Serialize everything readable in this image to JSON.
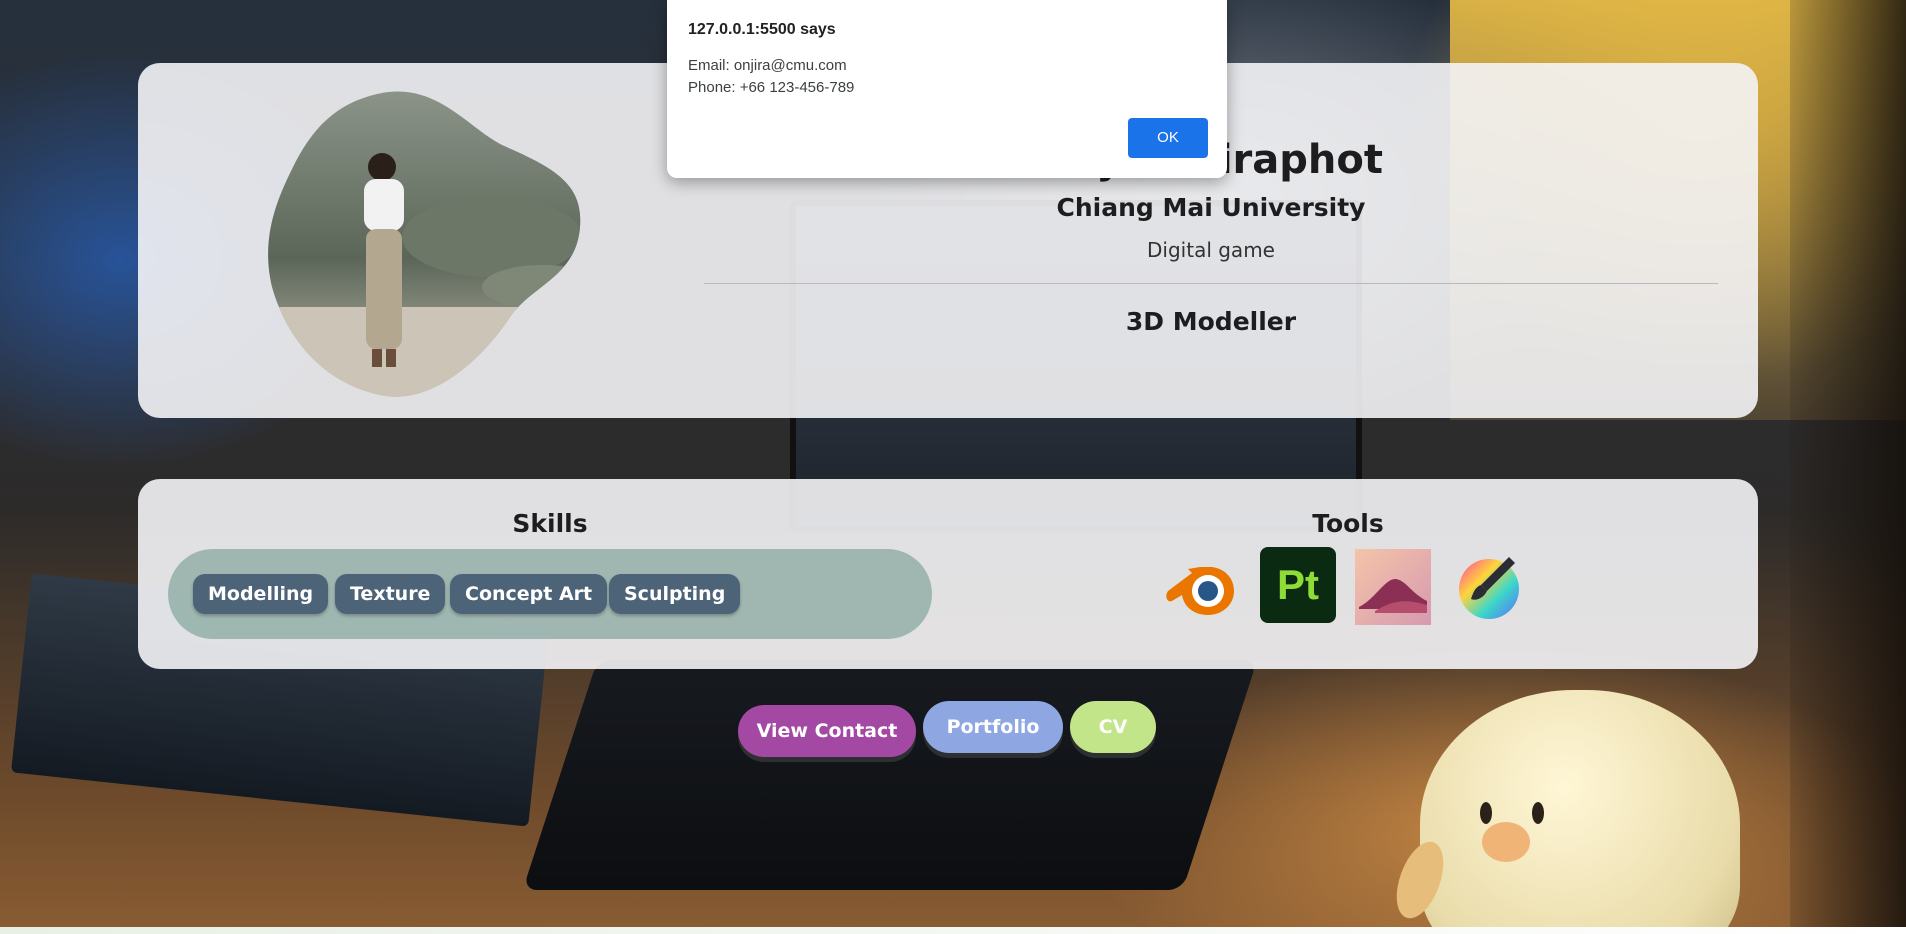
{
  "profile": {
    "name_visible": "Onjira Piraphot",
    "university": "Chiang Mai University",
    "major": "Digital game",
    "role": "3D Modeller"
  },
  "skills": {
    "title": "Skills",
    "items": [
      "Modelling",
      "Texture",
      "Concept Art",
      "Sculpting"
    ]
  },
  "tools": {
    "title": "Tools",
    "items": [
      "blender-icon",
      "substance-painter-icon",
      "affinity-photo-icon",
      "krita-icon"
    ]
  },
  "buttons": {
    "contact": "View Contact",
    "portfolio": "Portfolio",
    "cv": "CV"
  },
  "alert": {
    "title": "127.0.0.1:5500 says",
    "email": "Email: onjira@cmu.com",
    "phone": "Phone: +66 123-456-789",
    "ok": "OK"
  },
  "colors": {
    "contact_button": "#a349a4",
    "portfolio_button": "#8ea6e2",
    "cv_button": "#c2e58a",
    "skill_chip": "#4d6478",
    "ok_button": "#1a73e8"
  }
}
